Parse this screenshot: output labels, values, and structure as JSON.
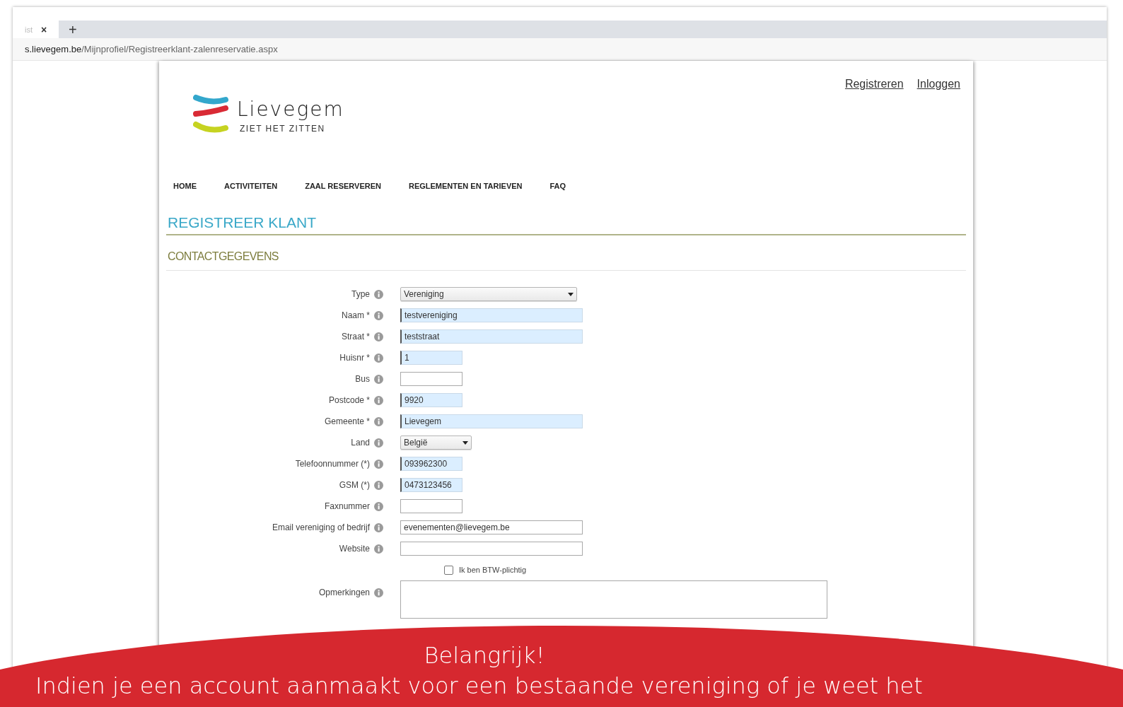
{
  "browser": {
    "tab": {
      "title": "ist",
      "close": "×"
    },
    "new_tab": "+",
    "address": {
      "host": "s.lievegem.be",
      "path": "/Mijnprofiel/Registreerklant-zalenreservatie.aspx"
    }
  },
  "header": {
    "logo": {
      "name": "Lievegem",
      "tagline": "ZIET HET ZITTEN"
    },
    "links": [
      "Registreren",
      "Inloggen"
    ]
  },
  "nav": [
    "HOME",
    "ACTIVITEITEN",
    "ZAAL RESERVEREN",
    "REGLEMENTEN EN TARIEVEN",
    "FAQ"
  ],
  "page_title": "REGISTREER KLANT",
  "section_title": "CONTACTGEGEVENS",
  "form": [
    {
      "label": "Type",
      "kind": "wide-select",
      "value": "Vereniging"
    },
    {
      "label": "Naam *",
      "kind": "long-text",
      "value": "testvereniging",
      "autofilled": true
    },
    {
      "label": "Straat *",
      "kind": "long-text",
      "value": "teststraat",
      "autofilled": true
    },
    {
      "label": "Huisnr *",
      "kind": "short-text",
      "value": "1",
      "autofilled": true
    },
    {
      "label": "Bus",
      "kind": "short-text",
      "autofilled": false
    },
    {
      "label": "Postcode *",
      "kind": "short-text",
      "value": "9920",
      "autofilled": true
    },
    {
      "label": "Gemeente *",
      "kind": "long-text",
      "value": "Lievegem",
      "autofilled": true
    },
    {
      "label": "Land",
      "kind": "narrow-select",
      "value": "België"
    },
    {
      "label": "Telefoonnummer (*)",
      "kind": "short-text",
      "value": "093962300",
      "autofilled": true
    },
    {
      "label": "GSM (*)",
      "kind": "short-text",
      "value": "0473123456",
      "autofilled": true
    },
    {
      "label": "Faxnummer",
      "kind": "short-text",
      "autofilled": false
    },
    {
      "label": "Email vereniging of bedrijf",
      "kind": "long-text",
      "value": "evenementen@lievegem.be",
      "autofilled": false
    },
    {
      "label": "Website",
      "kind": "long-text",
      "autofilled": false
    },
    {
      "label": "Ik ben BTW-plichtig",
      "kind": "checkbox",
      "checked": false
    },
    {
      "label": "Opmerkingen",
      "kind": "textarea"
    }
  ],
  "banner": {
    "title": "Belangrijk!",
    "text": "Indien je een account aanmaakt voor een bestaande vereniging of je weet het"
  }
}
